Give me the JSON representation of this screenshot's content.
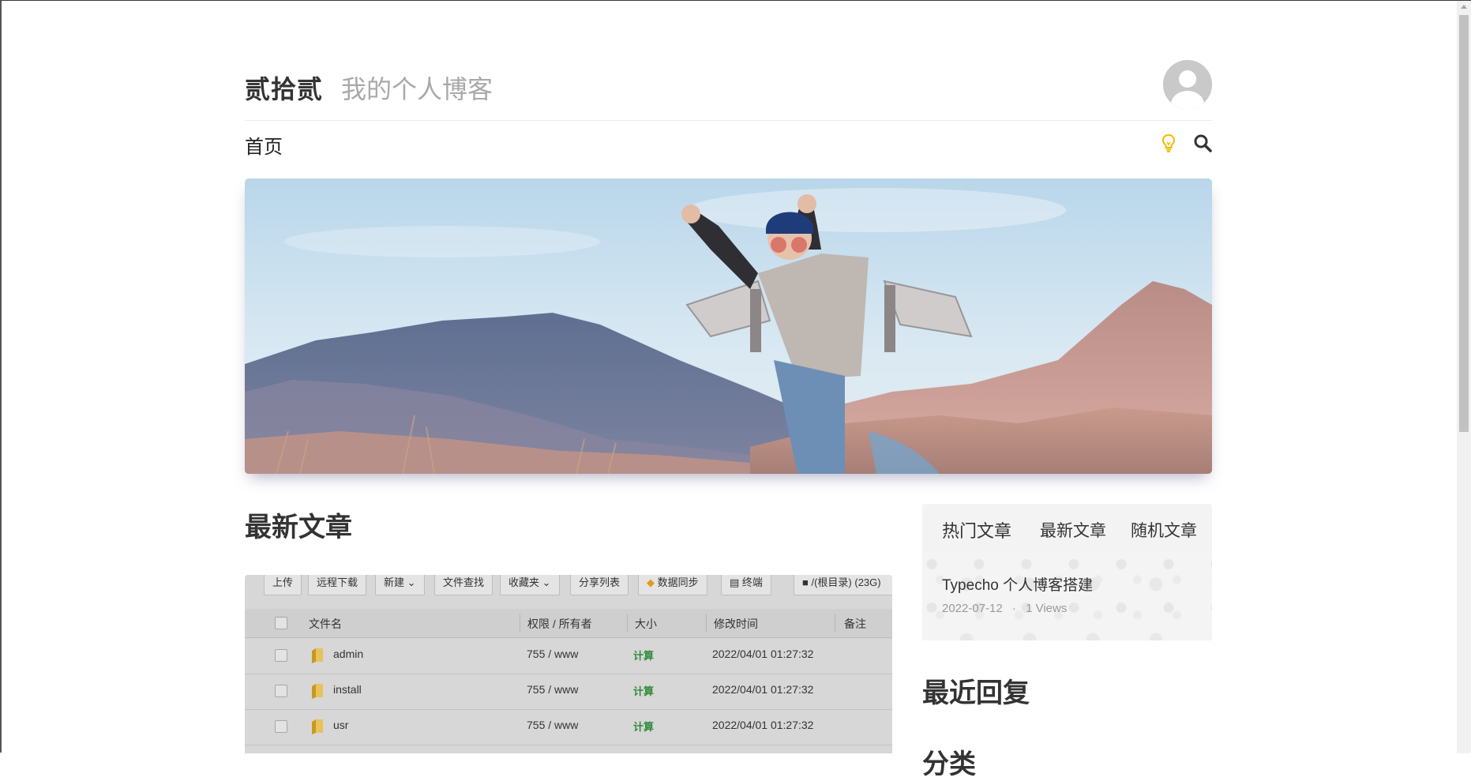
{
  "header": {
    "site_title": "贰拾贰",
    "site_subtitle": "我的个人博客"
  },
  "nav": {
    "home": "首页",
    "theme_toggle_icon": "lightbulb-icon",
    "search_icon": "search-icon"
  },
  "main": {
    "latest_title": "最新文章",
    "post_thumbnail": {
      "toolbar": [
        {
          "label": "上传"
        },
        {
          "label": "远程下载"
        },
        {
          "label": "新建"
        },
        {
          "label": "文件查找"
        },
        {
          "label": "收藏夹"
        },
        {
          "label": "分享列表"
        },
        {
          "label": "数据同步"
        },
        {
          "label": "终端"
        },
        {
          "label": "/(根目录) (23G)"
        }
      ],
      "columns": [
        "文件名",
        "权限 / 所有者",
        "大小",
        "修改时间",
        "备注"
      ],
      "rows": [
        {
          "name": "admin",
          "perm": "755 / www",
          "size": "计算",
          "mtime": "2022/04/01 01:27:32"
        },
        {
          "name": "install",
          "perm": "755 / www",
          "size": "计算",
          "mtime": "2022/04/01 01:27:32"
        },
        {
          "name": "usr",
          "perm": "755 / www",
          "size": "计算",
          "mtime": "2022/04/01 01:27:32"
        }
      ]
    }
  },
  "sidebar": {
    "tabs": [
      "热门文章",
      "最新文章",
      "随机文章"
    ],
    "posts": [
      {
        "title": "Typecho 个人博客搭建",
        "date": "2022-07-12",
        "sep": "·",
        "views": "1 Views"
      }
    ],
    "recent_replies_title": "最近回复",
    "categories_title": "分类"
  },
  "colors": {
    "accent_yellow": "#f5b800",
    "calc_green": "#2f8a3b"
  }
}
